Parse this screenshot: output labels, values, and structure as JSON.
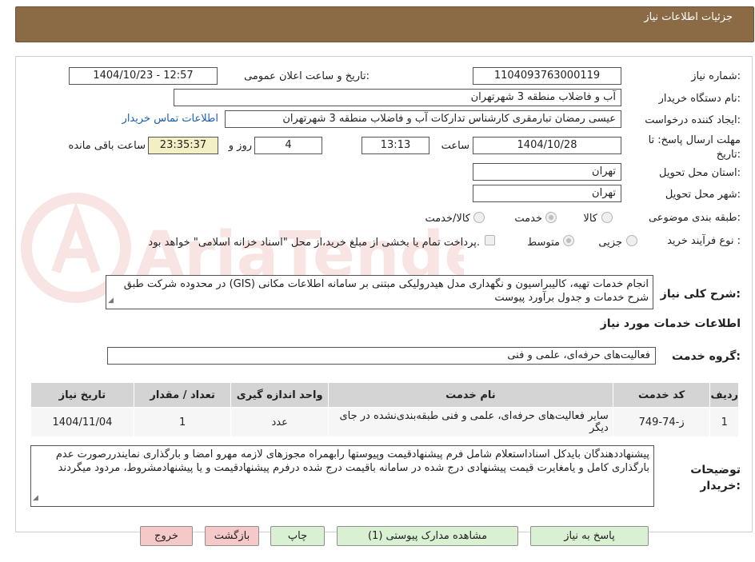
{
  "header": {
    "title": "جزئیات اطلاعات نیاز"
  },
  "fields": {
    "need_number_label": "شماره نیاز:",
    "need_number": "1104093763000119",
    "announce_label": "تاریخ و ساعت اعلان عمومی:",
    "announce_value": "1404/10/23 - 12:57",
    "buyer_org_label": "نام دستگاه خریدار:",
    "buyer_org": "آب و فاضلاب منطقه 3 شهرتهران",
    "requester_label": "ایجاد کننده درخواست:",
    "requester": "عیسی رمضان تبارمقری کارشناس تدارکات  آب و فاضلاب منطقه 3 شهرتهران",
    "contact_link": "اطلاعات تماس خریدار",
    "deadline_label": "مهلت ارسال پاسخ: تا تاریخ:",
    "deadline_date": "1404/10/28",
    "time_label": "ساعت",
    "deadline_time": "13:13",
    "days_value": "4",
    "days_label": "روز و",
    "remaining_time": "23:35:37",
    "remaining_label": "ساعت باقی مانده",
    "province_label": "استان محل تحویل:",
    "province": "تهران",
    "city_label": "شهر محل تحویل:",
    "city": "تهران",
    "category_label": "طبقه بندی موضوعی:",
    "category_options": [
      "کالا",
      "خدمت",
      "کالا/خدمت"
    ],
    "process_label": "نوع فرآیند خرید :",
    "process_options": [
      "جزیی",
      "متوسط"
    ],
    "payment_note": "پرداخت تمام یا بخشی از مبلغ خرید،از محل \"اسناد خزانه اسلامی\" خواهد بود."
  },
  "description": {
    "label": "شرح کلی نیاز:",
    "text": "انجام خدمات تهیه، کالیبراسیون و نگهداری مدل هیدرولیکی مبتنی بر سامانه اطلاعات مکانی (GIS) در محدوده شرکت طبق شرح خدمات و جدول برآورد پیوست"
  },
  "services": {
    "section_title": "اطلاعات خدمات مورد نیاز",
    "group_label": "گروه خدمت:",
    "group_value": "فعالیت‌های حرفه‌ای، علمی و فنی",
    "columns": [
      "ردیف",
      "کد خدمت",
      "نام خدمت",
      "واحد اندازه گیری",
      "تعداد / مقدار",
      "تاریخ نیاز"
    ],
    "rows": [
      [
        "1",
        "ز-74-749",
        "سایر فعالیت‌های حرفه‌ای، علمی و فنی طبقه‌بندی‌نشده در جای دیگر",
        "عدد",
        "1",
        "1404/11/04"
      ]
    ]
  },
  "buyer_notes": {
    "label": "توضیحات خریدار:",
    "text": "پیشنهاددهندگان بایدکل اسناداستعلام شامل فرم پیشنهادقیمت وپیوستها رابهمراه مجوزهای لازمه مهرو امضا و بارگذاری نمایندررصورت عدم بارگذاری کامل و یامغایرت قیمت پیشنهادی درج شده در سامانه باقیمت درج شده درفرم پیشنهادقیمت و یا پیشنهادمشروط، مردود میگردند"
  },
  "buttons": {
    "reply": "پاسخ به نیاز",
    "attachments": "مشاهده مدارک پیوستی (1)",
    "print": "چاپ",
    "back": "بازگشت",
    "exit": "خروج"
  },
  "colors": {
    "header_bg": "#8B6B45",
    "accent": "#d9f0d2",
    "danger": "#f6c9c9"
  },
  "watermark": {
    "brand": "AriaTender.neT"
  }
}
